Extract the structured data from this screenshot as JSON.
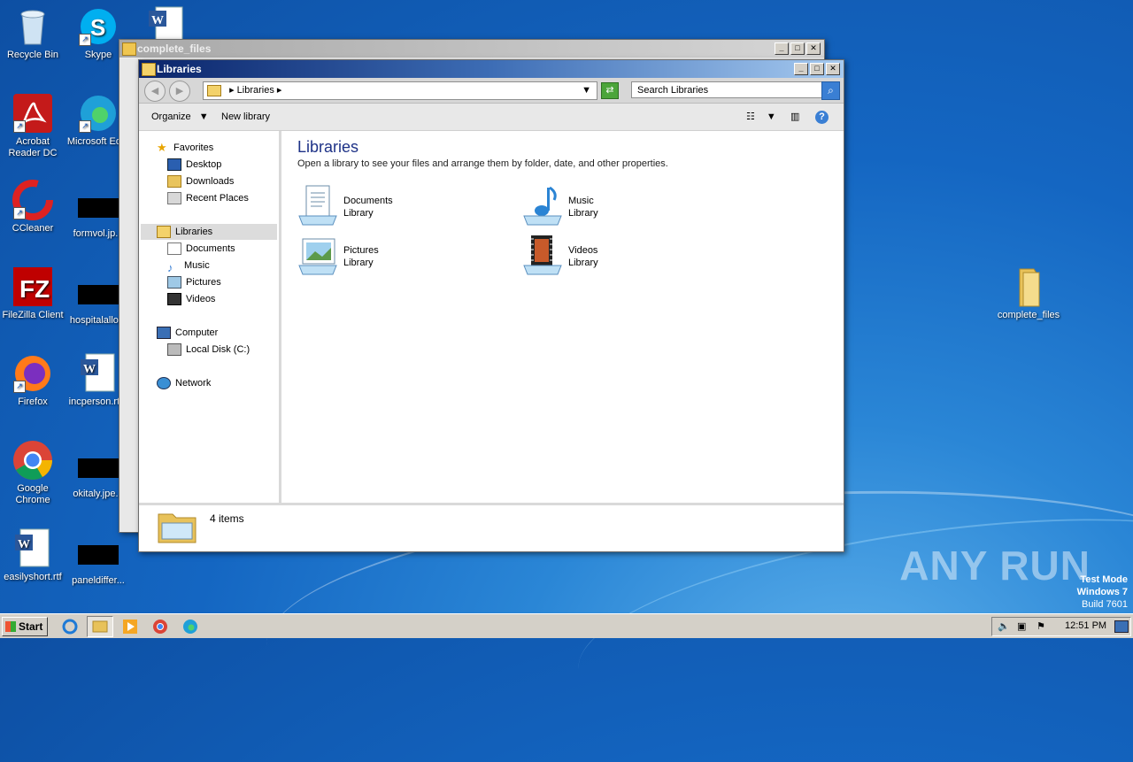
{
  "desktop": {
    "icons_left": [
      {
        "label": "Recycle Bin",
        "icon": "recycle-bin-icon"
      },
      {
        "label": "Acrobat Reader DC",
        "icon": "acrobat-icon"
      },
      {
        "label": "CCleaner",
        "icon": "ccleaner-icon"
      },
      {
        "label": "FileZilla Client",
        "icon": "filezilla-icon"
      },
      {
        "label": "Firefox",
        "icon": "firefox-icon"
      },
      {
        "label": "Google Chrome",
        "icon": "chrome-icon"
      },
      {
        "label": "easilyshort.rtf",
        "icon": "word-doc-icon"
      }
    ],
    "icons_col2": [
      {
        "label": "Skype",
        "icon": "skype-icon"
      },
      {
        "label": "Microsoft Ed...",
        "icon": "edge-icon"
      },
      {
        "label": "formvol.jp...",
        "icon": "image-thumb-icon"
      },
      {
        "label": "hospitalallo...",
        "icon": "image-thumb-icon"
      },
      {
        "label": "incperson.rt...",
        "icon": "word-doc-icon"
      },
      {
        "label": "okitaly.jpe...",
        "icon": "image-thumb-icon"
      },
      {
        "label": "paneldiffer...",
        "icon": "image-thumb-icon"
      }
    ],
    "icon_right": {
      "label": "complete_files",
      "icon": "folder-icon"
    }
  },
  "back_window": {
    "title": "complete_files"
  },
  "libraries_window": {
    "title": "Libraries",
    "address": {
      "current": "Libraries"
    },
    "search": {
      "placeholder": "Search Libraries"
    },
    "toolbar": {
      "organize": "Organize",
      "new_library": "New library"
    },
    "nav": {
      "favorites": "Favorites",
      "desktop": "Desktop",
      "downloads": "Downloads",
      "recent": "Recent Places",
      "libraries": "Libraries",
      "documents": "Documents",
      "music": "Music",
      "pictures": "Pictures",
      "videos": "Videos",
      "computer": "Computer",
      "local_disk": "Local Disk (C:)",
      "network": "Network"
    },
    "content": {
      "heading": "Libraries",
      "description": "Open a library to see your files and arrange them by folder, date, and other properties.",
      "libraries": [
        {
          "name": "Documents",
          "type": "Library",
          "icon": "documents-library-icon"
        },
        {
          "name": "Music",
          "type": "Library",
          "icon": "music-library-icon"
        },
        {
          "name": "Pictures",
          "type": "Library",
          "icon": "pictures-library-icon"
        },
        {
          "name": "Videos",
          "type": "Library",
          "icon": "videos-library-icon"
        }
      ]
    },
    "details": {
      "item_count": "4 items"
    }
  },
  "taskbar": {
    "start_label": "Start",
    "clock": "12:51 PM"
  },
  "watermark": "ANY RUN",
  "os_info": {
    "line1": "Test Mode",
    "line2": "Windows 7",
    "line3": "Build 7601"
  }
}
